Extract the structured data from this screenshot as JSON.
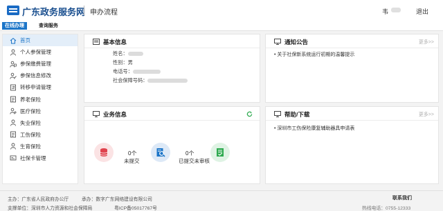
{
  "header": {
    "site_title": "广东政务服务网",
    "subtitle": "申办流程",
    "user_name": "韦",
    "logout": "退出"
  },
  "tabs": [
    {
      "label": "在线办理",
      "active": true
    },
    {
      "label": "查询服务",
      "active": false
    }
  ],
  "sidebar": {
    "items": [
      {
        "label": "首页",
        "icon": "home-icon",
        "active": true
      },
      {
        "label": "个人参保管理",
        "icon": "person-icon"
      },
      {
        "label": "参保缴费管理",
        "icon": "person-card-icon"
      },
      {
        "label": "参保信息修改",
        "icon": "person-edit-icon"
      },
      {
        "label": "转移申请管理",
        "icon": "transfer-icon"
      },
      {
        "label": "养老保险",
        "icon": "document-icon"
      },
      {
        "label": "医疗保险",
        "icon": "medical-icon"
      },
      {
        "label": "失业保险",
        "icon": "person-icon"
      },
      {
        "label": "工伤保险",
        "icon": "document-icon"
      },
      {
        "label": "生育保险",
        "icon": "person-icon"
      },
      {
        "label": "社保卡管理",
        "icon": "card-icon"
      }
    ]
  },
  "basic_info": {
    "title": "基本信息",
    "name_label": "姓名：",
    "gender_label": "性别：",
    "gender_value": "男",
    "phone_label": "电话号：",
    "ssn_label": "社会保障号码："
  },
  "notice": {
    "title": "通知公告",
    "more": "更多>>",
    "items": [
      "关于社保新系统运行初期的温馨提示"
    ]
  },
  "business": {
    "title": "业务信息",
    "stats": [
      {
        "count": "0个",
        "label": "未提交"
      },
      {
        "count": "0个",
        "label": "已提交未审核"
      }
    ]
  },
  "help": {
    "title": "帮助/下载",
    "more": "更多>>",
    "items": [
      "深圳市工伤保险康复辅助器具申请表"
    ]
  },
  "footer": {
    "host": "主办：广东省人民政府办公厅",
    "organizer": "承办：数字广东网络建设有限公司",
    "support": "支撑单位：深圳市人力资源和社会保障局",
    "icp": "粤ICP备05017767号",
    "contact": "联系我们",
    "phone": "热线电话：0755-12333"
  },
  "colors": {
    "brand": "#1c75c8",
    "stat_red": "#e0424d",
    "stat_blue": "#1c75c8",
    "stat_green": "#2eaa4f"
  }
}
